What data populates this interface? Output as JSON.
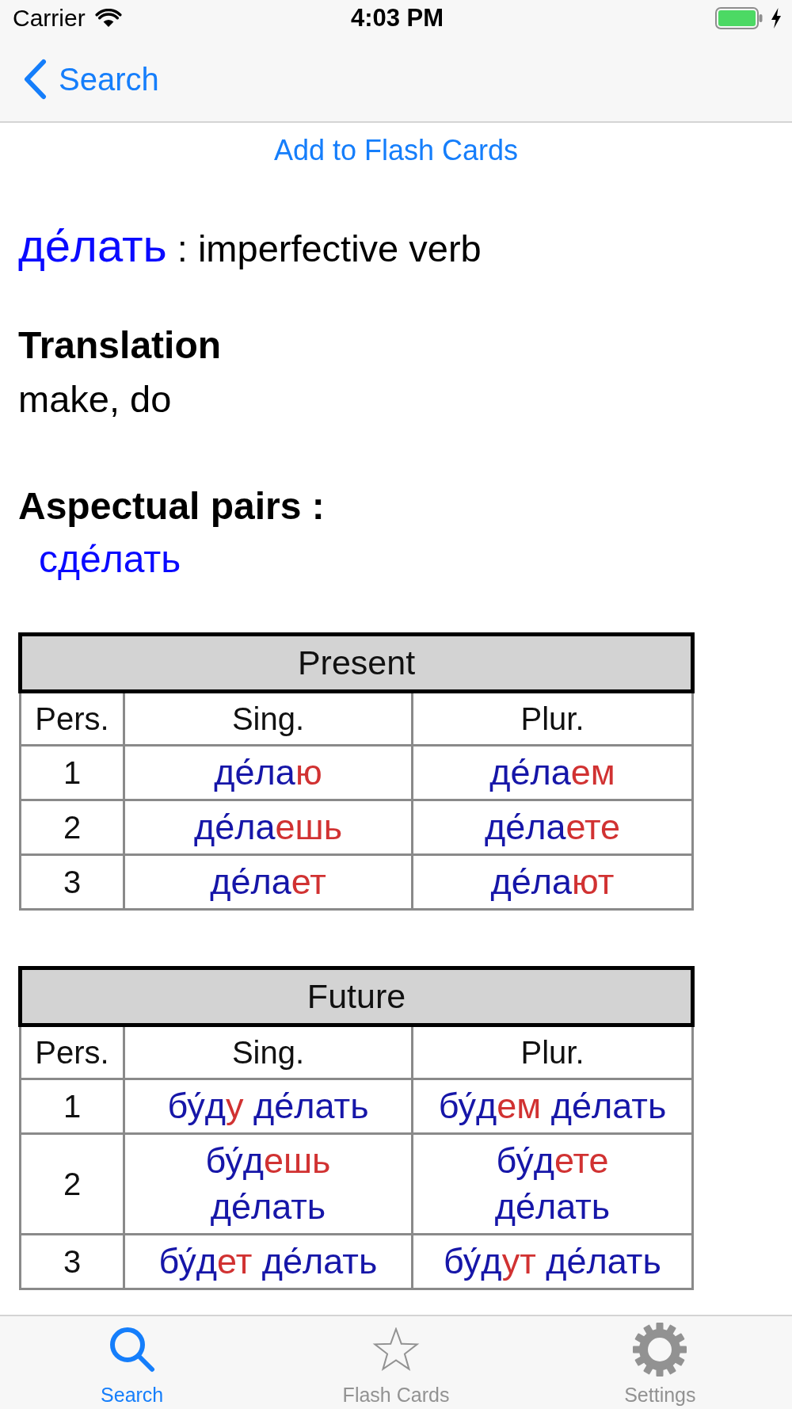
{
  "status_bar": {
    "carrier": "Carrier",
    "time": "4:03 PM"
  },
  "nav_bar": {
    "back_label": "Search"
  },
  "add_button": "Add to Flash Cards",
  "entry": {
    "word": "де́лать",
    "description": ": imperfective verb"
  },
  "translation": {
    "heading": "Translation",
    "text": "make, do"
  },
  "aspectual_pairs": {
    "heading": "Aspectual pairs :",
    "items": [
      "сде́лать"
    ]
  },
  "tables": [
    {
      "title": "Present",
      "columns": [
        "Pers.",
        "Sing.",
        "Plur."
      ],
      "rows": [
        {
          "person": "1",
          "singular": [
            [
              {
                "text": "де́ла",
                "kind": "stem"
              },
              {
                "text": "ю",
                "kind": "ending"
              }
            ]
          ],
          "plural": [
            [
              {
                "text": "де́ла",
                "kind": "stem"
              },
              {
                "text": "ем",
                "kind": "ending"
              }
            ]
          ]
        },
        {
          "person": "2",
          "singular": [
            [
              {
                "text": "де́ла",
                "kind": "stem"
              },
              {
                "text": "ешь",
                "kind": "ending"
              }
            ]
          ],
          "plural": [
            [
              {
                "text": "де́ла",
                "kind": "stem"
              },
              {
                "text": "ете",
                "kind": "ending"
              }
            ]
          ]
        },
        {
          "person": "3",
          "singular": [
            [
              {
                "text": "де́ла",
                "kind": "stem"
              },
              {
                "text": "ет",
                "kind": "ending"
              }
            ]
          ],
          "plural": [
            [
              {
                "text": "де́ла",
                "kind": "stem"
              },
              {
                "text": "ют",
                "kind": "ending"
              }
            ]
          ]
        }
      ]
    },
    {
      "title": "Future",
      "columns": [
        "Pers.",
        "Sing.",
        "Plur."
      ],
      "rows": [
        {
          "person": "1",
          "singular": [
            [
              {
                "text": "бу́д",
                "kind": "stem"
              },
              {
                "text": "у",
                "kind": "ending"
              }
            ],
            [
              {
                "text": "де́лать",
                "kind": "stem"
              }
            ]
          ],
          "plural": [
            [
              {
                "text": "бу́д",
                "kind": "stem"
              },
              {
                "text": "ем",
                "kind": "ending"
              }
            ],
            [
              {
                "text": "де́лать",
                "kind": "stem"
              }
            ]
          ]
        },
        {
          "person": "2",
          "singular": [
            [
              {
                "text": "бу́д",
                "kind": "stem"
              },
              {
                "text": "ешь",
                "kind": "ending"
              }
            ],
            [
              {
                "text": "де́лать",
                "kind": "stem"
              }
            ]
          ],
          "plural": [
            [
              {
                "text": "бу́д",
                "kind": "stem"
              },
              {
                "text": "ете",
                "kind": "ending"
              }
            ],
            [
              {
                "text": "де́лать",
                "kind": "stem"
              }
            ]
          ]
        },
        {
          "person": "3",
          "singular": [
            [
              {
                "text": "бу́д",
                "kind": "stem"
              },
              {
                "text": "ет",
                "kind": "ending"
              }
            ],
            [
              {
                "text": "де́лать",
                "kind": "stem"
              }
            ]
          ],
          "plural": [
            [
              {
                "text": "бу́д",
                "kind": "stem"
              },
              {
                "text": "ут",
                "kind": "ending"
              }
            ],
            [
              {
                "text": "де́лать",
                "kind": "stem"
              }
            ]
          ]
        }
      ]
    }
  ],
  "tab_bar": {
    "tabs": [
      {
        "label": "Search",
        "selected": true
      },
      {
        "label": "Flash Cards",
        "selected": false
      },
      {
        "label": "Settings",
        "selected": false
      }
    ]
  }
}
